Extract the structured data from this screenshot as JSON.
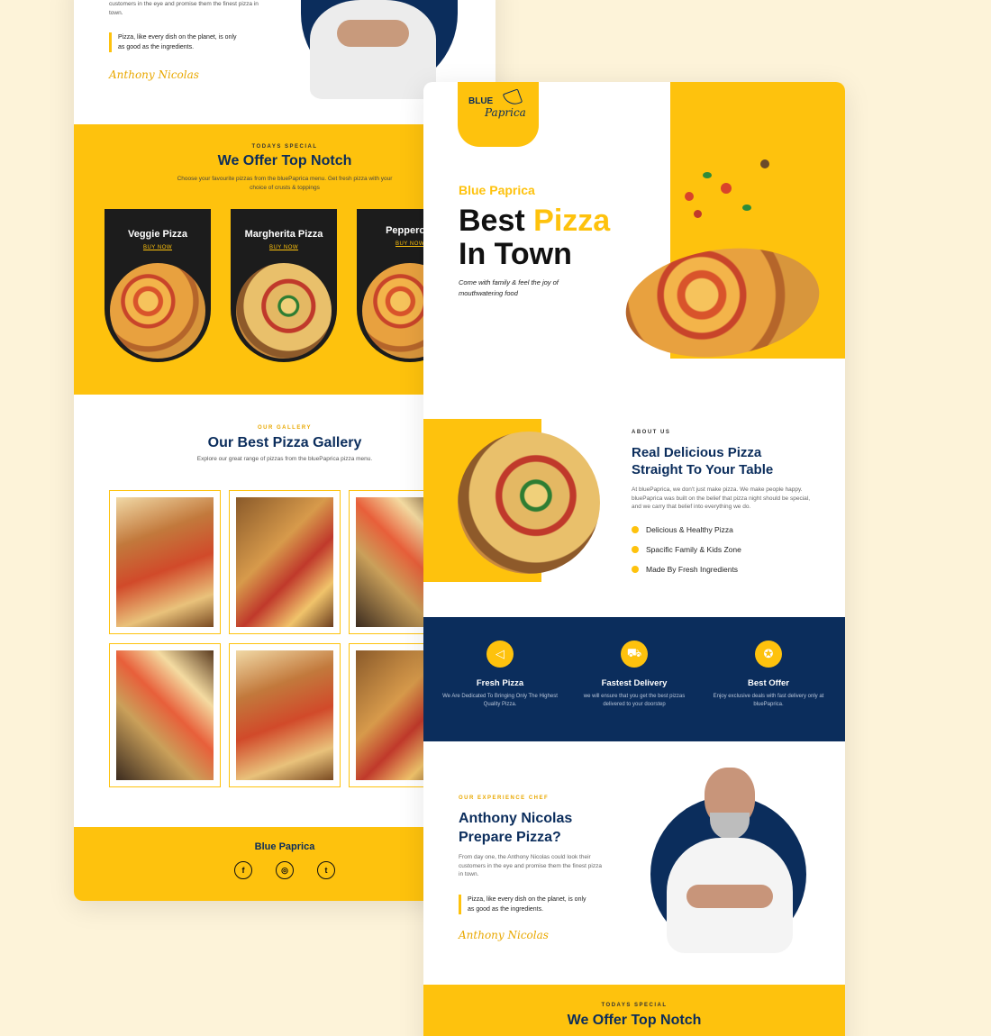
{
  "back": {
    "chef_text_cut": "customers in the eye and promise them the finest pizza in town.",
    "quote": "Pizza, like every dish on the planet, is only as good as the ingredients.",
    "signature": "Anthony Nicolas",
    "special": {
      "kicker": "TODAYS SPECIAL",
      "title": "We Offer Top Notch",
      "desc": "Choose your favourite pizzas from the bluePaprica menu. Get fresh pizza with your choice of crusts & toppings",
      "items": [
        {
          "name": "Veggie Pizza",
          "cta": "BUY NOW"
        },
        {
          "name": "Margherita Pizza",
          "cta": "BUY NOW"
        },
        {
          "name": "Pepperoni",
          "cta": "BUY NOW"
        }
      ]
    },
    "gallery": {
      "kicker": "OUR GALLERY",
      "title": "Our Best Pizza Gallery",
      "desc": "Explore our great range of pizzas from the bluePaprica pizza menu."
    },
    "footer": {
      "brand": "Blue Paprica",
      "social": [
        "f",
        "◎",
        "t"
      ]
    }
  },
  "front": {
    "logo_top": "BLUE",
    "logo_script": "Paprica",
    "hero": {
      "kicker": "Blue Paprica",
      "title_line1_a": "Best ",
      "title_line1_b": "Pizza",
      "title_line2": "In Town",
      "sub": "Come with family & feel the joy of mouthwatering food"
    },
    "about": {
      "kicker": "ABOUT US",
      "title": "Real Delicious Pizza Straight To Your Table",
      "desc": "At bluePaprica, we don't just make pizza. We make people happy. bluePaprica was built on the belief that pizza night should be special, and we carry that belief into everything we do.",
      "bullets": [
        "Delicious & Healthy Pizza",
        "Spacific Family & Kids Zone",
        "Made By Fresh Ingredients"
      ]
    },
    "features": [
      {
        "icon": "pizza-slice-icon",
        "glyph": "◁",
        "title": "Fresh Pizza",
        "desc": "We Are Dedicated To Bringing Only The Highest Quality Pizza."
      },
      {
        "icon": "delivery-scooter-icon",
        "glyph": "⛟",
        "title": "Fastest Delivery",
        "desc": "we will ensure that you get the best pizzas delivered to your doorstep"
      },
      {
        "icon": "offer-tag-icon",
        "glyph": "✪",
        "title": "Best Offer",
        "desc": "Enjoy exclusive deals with fast delivery only at bluePaprica."
      }
    ],
    "chef": {
      "kicker": "OUR EXPERIENCE CHEF",
      "title": "Anthony Nicolas Prepare Pizza?",
      "desc": "From day one, the Anthony Nicolas could look their customers in the eye and promise them the finest pizza in town.",
      "quote": "Pizza, like every dish on the planet, is only as good as the ingredients.",
      "signature": "Anthony Nicolas"
    },
    "special": {
      "kicker": "TODAYS SPECIAL",
      "title": "We Offer Top Notch"
    }
  },
  "colors": {
    "accent": "#fec20d",
    "navy": "#0b2d5c",
    "background": "#fdf3d9"
  }
}
